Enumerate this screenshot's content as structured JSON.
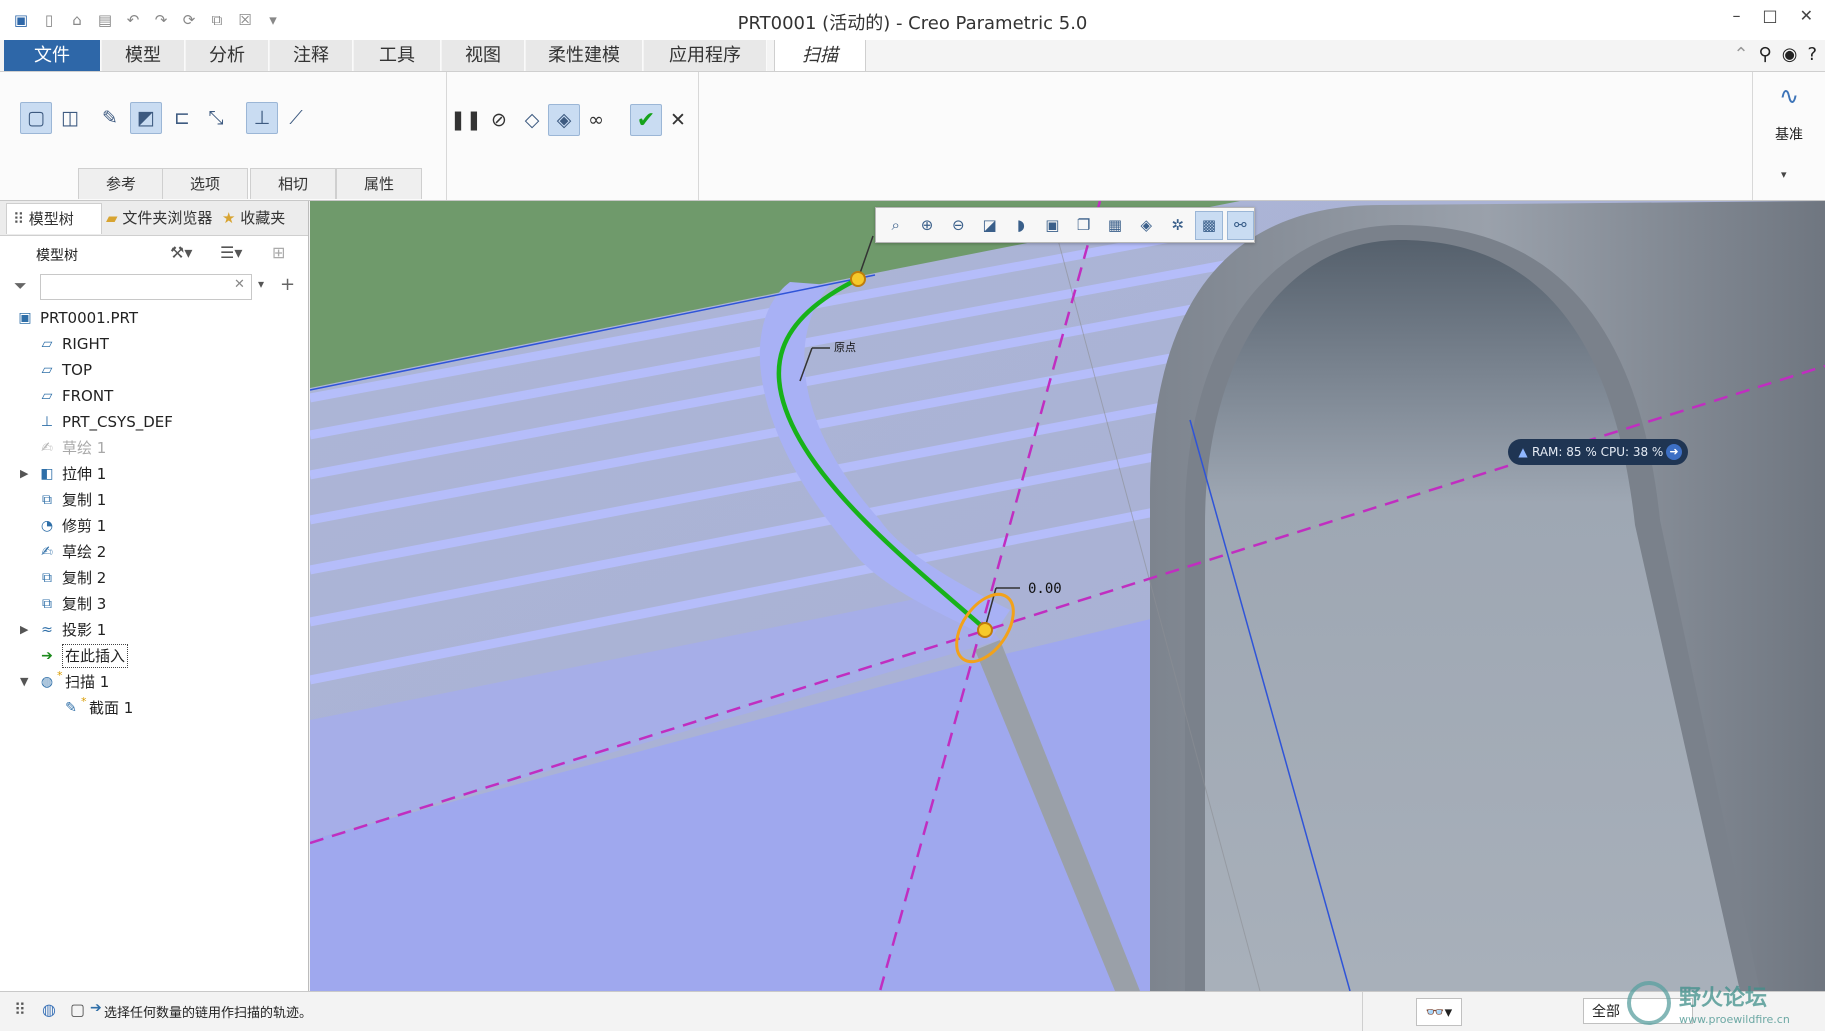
{
  "window": {
    "title": "PRT0001 (活动的) - Creo Parametric 5.0",
    "controls": [
      "–",
      "□",
      "✕"
    ]
  },
  "quick_access": [
    "new-icon",
    "open-icon",
    "save-icon",
    "undo-icon",
    "redo-icon",
    "regenerate-icon",
    "windows-icon",
    "close-window-icon",
    "customize-icon"
  ],
  "menu": {
    "tabs": [
      "文件",
      "模型",
      "分析",
      "注释",
      "工具",
      "视图",
      "柔性建模",
      "应用程序",
      "扫描"
    ],
    "active_tab": "扫描"
  },
  "ribbon": {
    "subtabs": [
      "参考",
      "选项",
      "相切",
      "属性"
    ],
    "datum_label": "基准"
  },
  "nav": {
    "tabs": [
      "模型树",
      "文件夹浏览器",
      "收藏夹"
    ],
    "tree_title": "模型树",
    "search_placeholder": ""
  },
  "tree": [
    {
      "label": "PRT0001.PRT",
      "icon": "part-icon",
      "indent": 0,
      "expander": "",
      "state": "normal"
    },
    {
      "label": "RIGHT",
      "icon": "datum-plane-icon",
      "indent": 1,
      "expander": "",
      "state": "normal"
    },
    {
      "label": "TOP",
      "icon": "datum-plane-icon",
      "indent": 1,
      "expander": "",
      "state": "normal"
    },
    {
      "label": "FRONT",
      "icon": "datum-plane-icon",
      "indent": 1,
      "expander": "",
      "state": "normal"
    },
    {
      "label": "PRT_CSYS_DEF",
      "icon": "csys-icon",
      "indent": 1,
      "expander": "",
      "state": "normal"
    },
    {
      "label": "草绘 1",
      "icon": "sketch-icon",
      "indent": 1,
      "expander": "",
      "state": "dim"
    },
    {
      "label": "拉伸 1",
      "icon": "extrude-icon",
      "indent": 1,
      "expander": "▶",
      "state": "normal"
    },
    {
      "label": "复制 1",
      "icon": "copy-icon",
      "indent": 1,
      "expander": "",
      "state": "normal"
    },
    {
      "label": "修剪 1",
      "icon": "trim-icon",
      "indent": 1,
      "expander": "",
      "state": "normal"
    },
    {
      "label": "草绘 2",
      "icon": "sketch-icon",
      "indent": 1,
      "expander": "",
      "state": "normal"
    },
    {
      "label": "复制 2",
      "icon": "copy-icon",
      "indent": 1,
      "expander": "",
      "state": "normal"
    },
    {
      "label": "复制 3",
      "icon": "copy-icon",
      "indent": 1,
      "expander": "",
      "state": "normal"
    },
    {
      "label": "投影 1",
      "icon": "projection-icon",
      "indent": 1,
      "expander": "▶",
      "state": "normal"
    },
    {
      "label": "在此插入",
      "icon": "insert-arrow-icon",
      "indent": 1,
      "expander": "",
      "state": "insert"
    },
    {
      "label": "扫描 1",
      "icon": "sweep-icon",
      "indent": 1,
      "expander": "▼",
      "state": "new"
    },
    {
      "label": "截面 1",
      "icon": "section-icon",
      "indent": 2,
      "expander": "",
      "state": "new"
    }
  ],
  "viewport": {
    "curve_label": "原点",
    "dimension_value": "0.00",
    "perf": "RAM: 85 %  CPU: 38 %"
  },
  "status": {
    "message": "选择任何数量的链用作扫描的轨迹。",
    "filter_value": "全部"
  },
  "watermark": {
    "text": "野火论坛",
    "url": "www.proewildfire.cn"
  },
  "colors": {
    "file_tab": "#2e67a8",
    "background_green": "#6f9a6b",
    "surface_lavender": "#9fa8ee",
    "tube_gray": "#8d949f",
    "trajectory_green": "#17b21a",
    "datum_magenta": "#c02ec0",
    "handle_orange": "#f2a21a"
  }
}
